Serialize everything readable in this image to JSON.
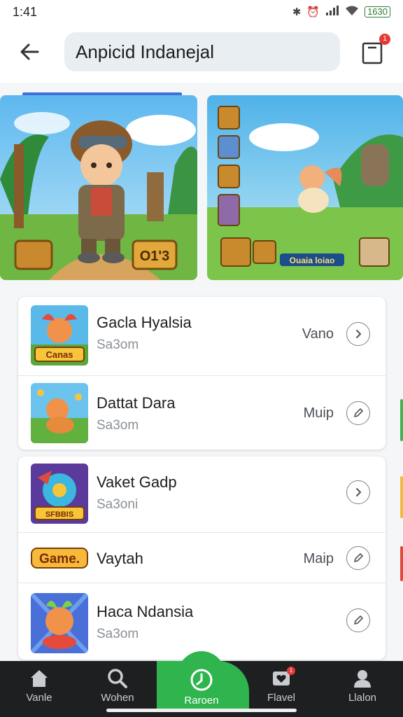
{
  "status": {
    "time": "1:41",
    "battery": "1630"
  },
  "header": {
    "search_text": "Anpicid Indanejal",
    "cart_badge": "1"
  },
  "banners": [
    {
      "id": "banner-1",
      "tag": "O1'3"
    },
    {
      "id": "banner-2",
      "tag": "Ouaia loiao"
    }
  ],
  "list_group_1": [
    {
      "title": "Gacla Hyalsia",
      "subtitle": "Sa3om",
      "action": "Vano",
      "button": "chevron",
      "thumb_text": "Canas"
    },
    {
      "title": "Dattat Dara",
      "subtitle": "Sa3om",
      "action": "Muip",
      "button": "pencil"
    }
  ],
  "list_group_2": [
    {
      "title": "Vaket Gadp",
      "subtitle": "Sa3oni",
      "action": "",
      "button": "chevron",
      "thumb_text": "SFBBIS"
    },
    {
      "title": "Vaytah",
      "subtitle": "",
      "action": "Maip",
      "button": "pencil",
      "thumb_text": "Game."
    },
    {
      "title": "Haca Ndansia",
      "subtitle": "Sa3om",
      "action": "",
      "button": "pencil"
    }
  ],
  "nav": [
    {
      "label": "Vanle",
      "icon": "home-icon"
    },
    {
      "label": "Wohen",
      "icon": "search-icon"
    },
    {
      "label": "Raroen",
      "icon": "compass-icon",
      "active": true
    },
    {
      "label": "Flavel",
      "icon": "heart-box-icon",
      "badge": "1"
    },
    {
      "label": "Llalon",
      "icon": "user-icon"
    }
  ],
  "colors": {
    "accent": "#2fb44e",
    "nav_bg": "#1e1f21",
    "badge": "#e53935",
    "banner_accent": "#3f6fd8"
  }
}
